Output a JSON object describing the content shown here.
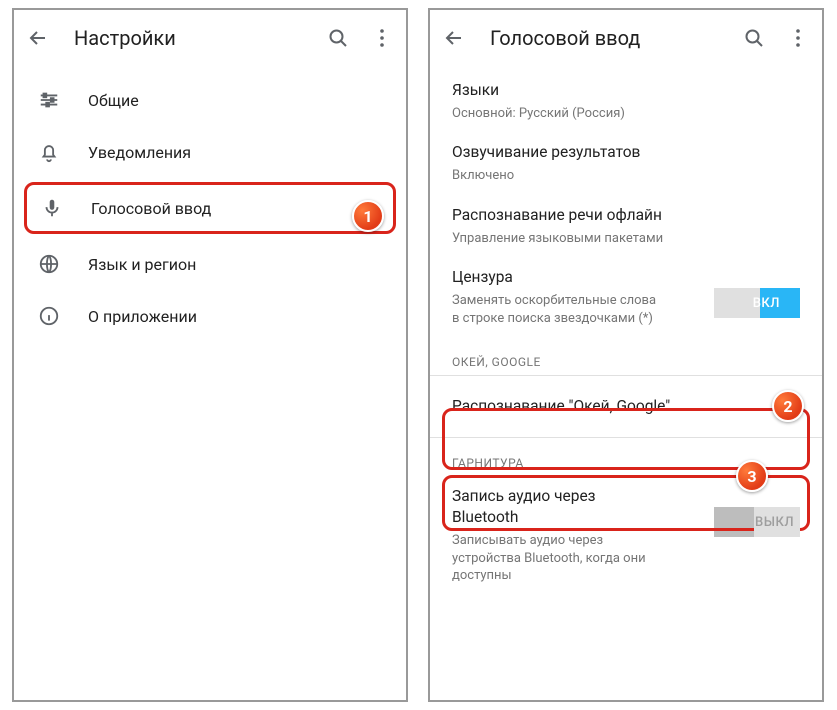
{
  "left": {
    "title": "Настройки",
    "items": [
      {
        "label": "Общие"
      },
      {
        "label": "Уведомления"
      },
      {
        "label": "Голосовой ввод"
      },
      {
        "label": "Язык и регион"
      },
      {
        "label": "О приложении"
      }
    ]
  },
  "right": {
    "title": "Голосовой ввод",
    "languages": {
      "primary": "Языки",
      "secondary": "Основной: Русский (Россия)"
    },
    "speakResults": {
      "primary": "Озвучивание результатов",
      "secondary": "Включено"
    },
    "offline": {
      "primary": "Распознавание речи офлайн",
      "secondary": "Управление языковыми пакетами"
    },
    "censor": {
      "primary": "Цензура",
      "secondary": "Заменять оскорбительные слова в строке поиска звездочками (*)",
      "switch": "ВКЛ"
    },
    "sectionOkGoogle": "ОКЕЙ, GOOGLE",
    "okGoogle": {
      "primary": "Распознавание \"Окей, Google\""
    },
    "sectionHeadset": "ГАРНИТУРА",
    "bluetooth": {
      "primary": "Запись аудио через Bluetooth",
      "secondary": "Записывать аудио через устройства Bluetooth, когда они доступны",
      "switch": "ВЫКЛ"
    }
  },
  "badges": {
    "b1": "1",
    "b2": "2",
    "b3": "3"
  }
}
